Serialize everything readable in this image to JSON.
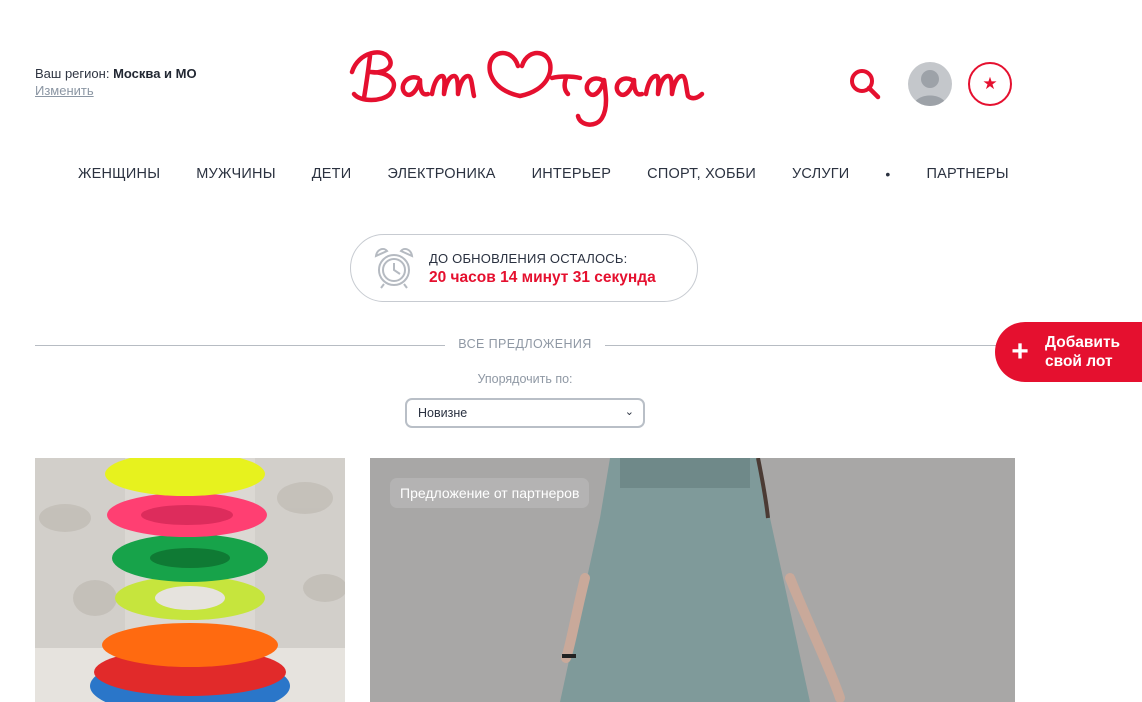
{
  "header": {
    "region_prefix": "Ваш регион:",
    "region_name": "Москва и МО",
    "change_link": "Изменить",
    "logo_text": "Вам Отдам",
    "brand_color": "#e5102f",
    "icons": [
      "search-icon",
      "user-icon",
      "star-icon"
    ]
  },
  "nav": {
    "items": [
      {
        "label": "ЖЕНЩИНЫ"
      },
      {
        "label": "МУЖЧИНЫ"
      },
      {
        "label": "ДЕТИ"
      },
      {
        "label": "ЭЛЕКТРОНИКА"
      },
      {
        "label": "ИНТЕРЬЕР"
      },
      {
        "label": "СПОРТ, ХОББИ"
      },
      {
        "label": "УСЛУГИ"
      },
      {
        "label": "•"
      },
      {
        "label": "ПАРТНЕРЫ"
      }
    ]
  },
  "timer": {
    "caption": "ДО ОБНОВЛЕНИЯ ОСТАЛОСЬ:",
    "value": "20 часов 14 минут 31 секунда"
  },
  "section": {
    "title": "ВСЕ ПРЕДЛОЖЕНИЯ"
  },
  "sort": {
    "label": "Упорядочить по:",
    "selected": "Новизне"
  },
  "add_lot": {
    "line1": "Добавить",
    "line2": "свой лот"
  },
  "cards": [
    {
      "image": "stacking-rings-toy-photo"
    },
    {
      "image": "blue-dress-photo",
      "badge": "Предложение от партнеров"
    }
  ]
}
